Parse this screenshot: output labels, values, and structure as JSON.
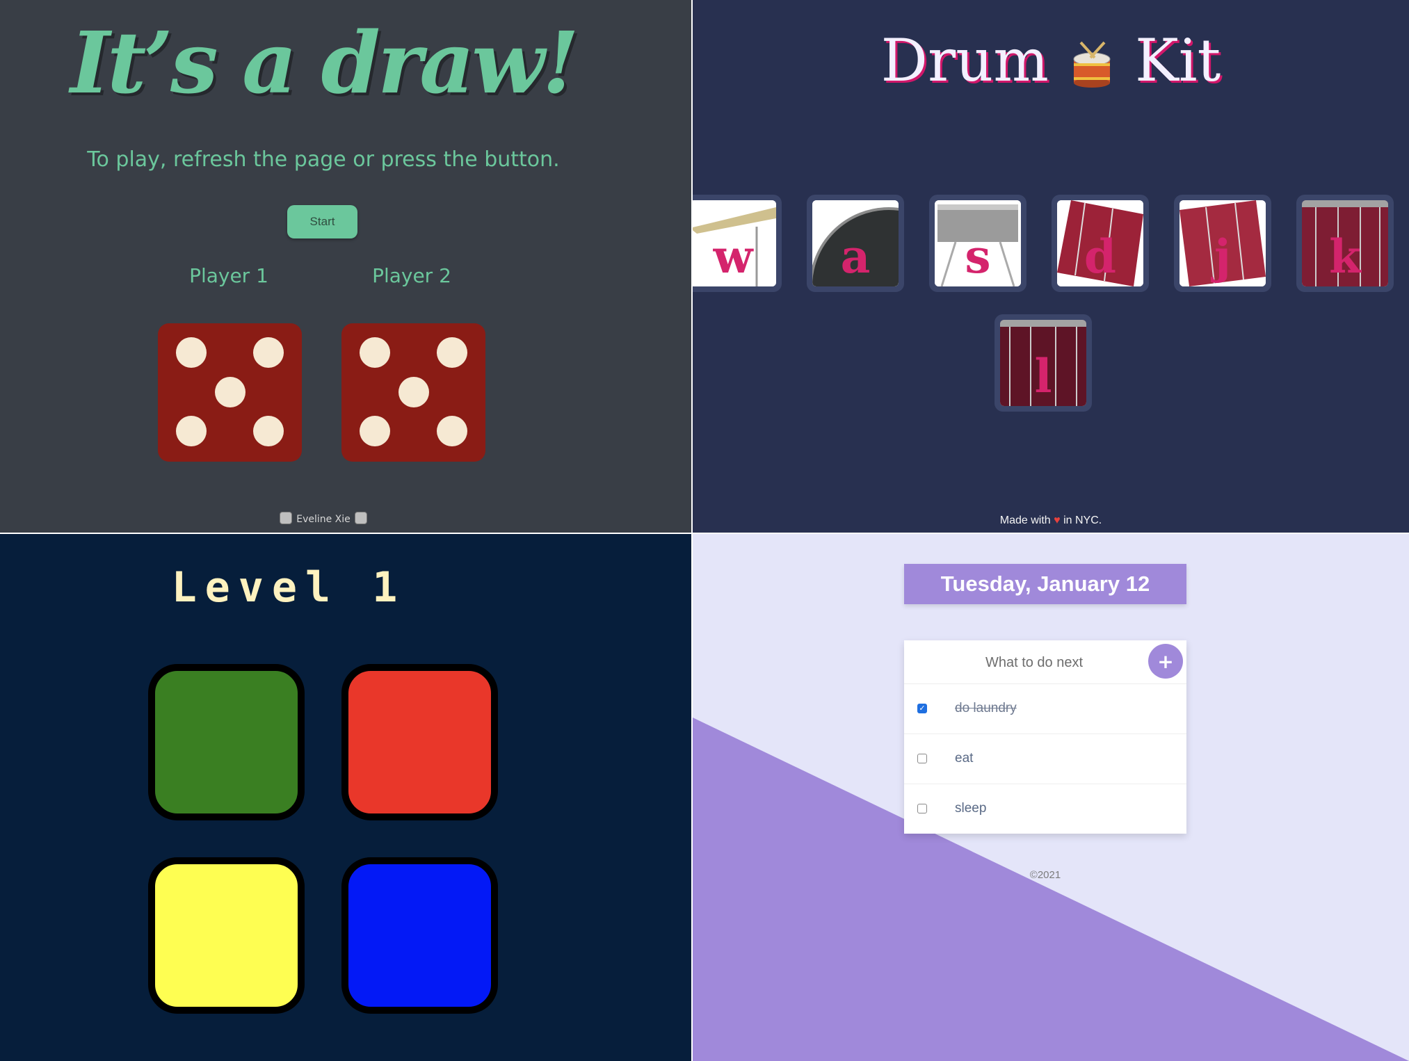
{
  "dice_game": {
    "title": "It’s a draw!",
    "subtitle": "To play, refresh the page or press the button.",
    "start_label": "Start",
    "players": [
      {
        "label": "Player 1",
        "die_value": 5
      },
      {
        "label": "Player 2",
        "die_value": 5
      }
    ],
    "footer": "Eveline Xie",
    "colors": {
      "background": "#393e46",
      "accent": "#6bc79c",
      "die": "#8a1c15",
      "pip": "#f6e9d3"
    }
  },
  "drum_kit": {
    "title_left": "Drum",
    "title_icon": "drum-icon",
    "title_right": "Kit",
    "keys": [
      {
        "letter": "w",
        "instrument": "crash-cymbal"
      },
      {
        "letter": "a",
        "instrument": "kick-drum"
      },
      {
        "letter": "s",
        "instrument": "snare-drum"
      },
      {
        "letter": "d",
        "instrument": "tom-1"
      },
      {
        "letter": "j",
        "instrument": "tom-2"
      },
      {
        "letter": "k",
        "instrument": "tom-3"
      },
      {
        "letter": "l",
        "instrument": "tom-4"
      }
    ],
    "footer_before": "Made with",
    "footer_icon": "heart-icon",
    "footer_after": "in NYC.",
    "colors": {
      "background": "#283050",
      "letter": "#d4246c",
      "key_border": "#3b4569"
    }
  },
  "simon_game": {
    "level_title": "Level 1",
    "buttons": [
      {
        "color_name": "green",
        "color": "#3a7f22"
      },
      {
        "color_name": "red",
        "color": "#e9372a"
      },
      {
        "color_name": "yellow",
        "color": "#fefe52"
      },
      {
        "color_name": "blue",
        "color": "#0319f6"
      }
    ],
    "colors": {
      "background": "#061e3b",
      "title": "#fef2bf"
    }
  },
  "todo_app": {
    "date": "Tuesday, January 12",
    "input_placeholder": "What to do next",
    "add_label": "+",
    "items": [
      {
        "text": "do laundry",
        "checked": true
      },
      {
        "text": "eat",
        "checked": false
      },
      {
        "text": "sleep",
        "checked": false
      }
    ],
    "footer": "©2021",
    "colors": {
      "background": "#e4e5f9",
      "accent": "#a089da"
    }
  }
}
